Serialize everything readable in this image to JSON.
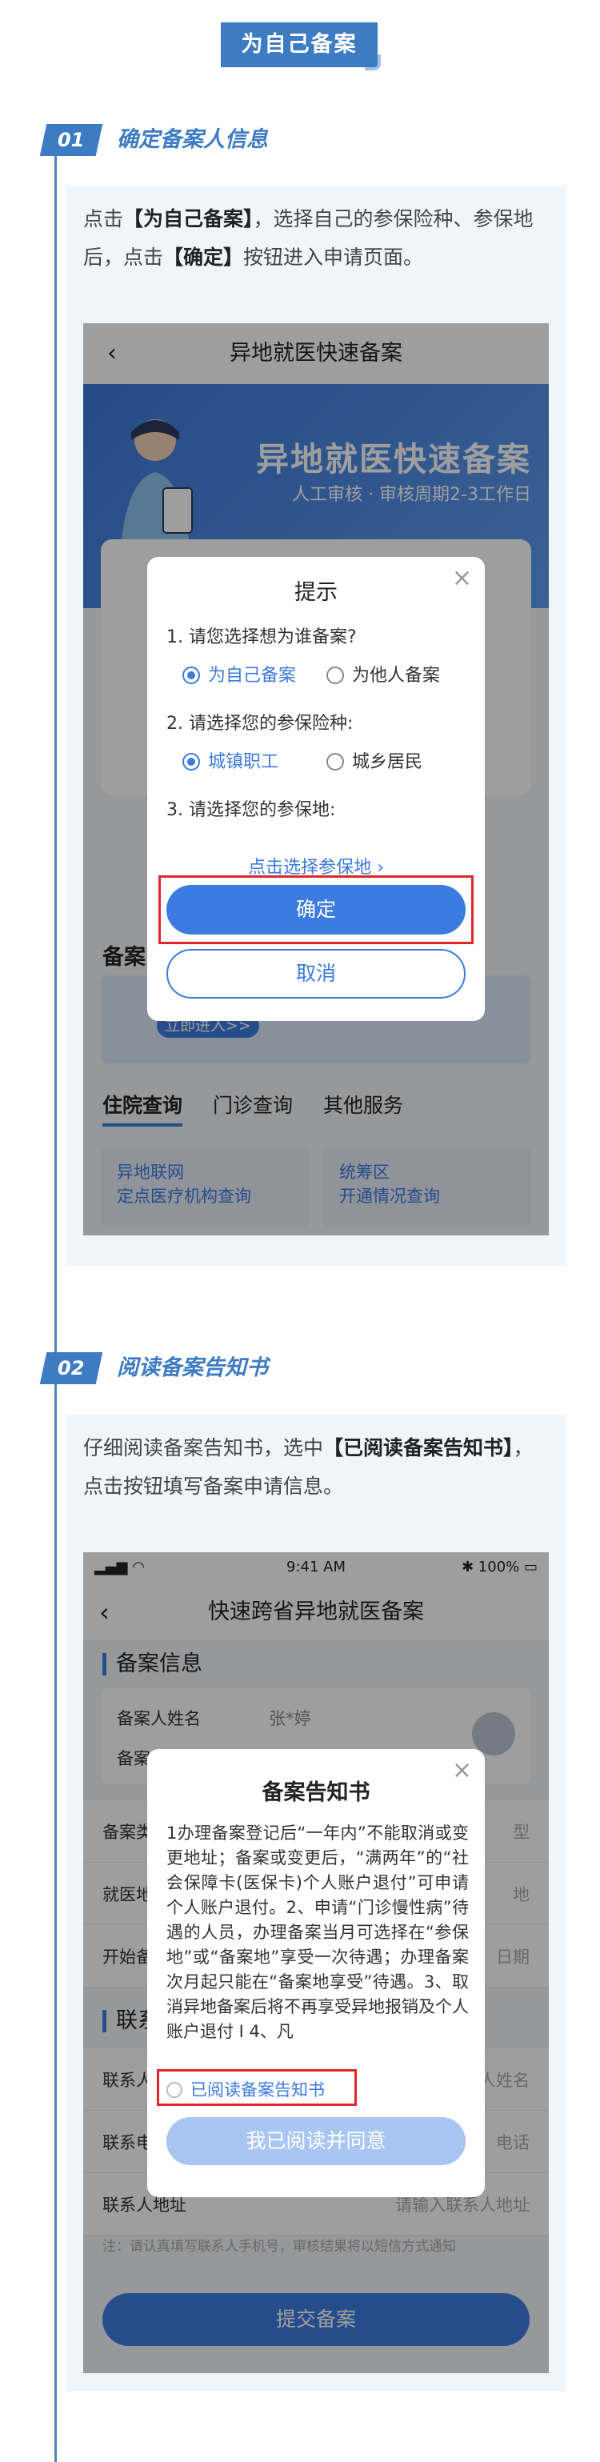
{
  "header": {
    "title": "为自己备案"
  },
  "step1": {
    "num": "01",
    "title": "确定备案人信息",
    "desc": [
      "点击",
      "【为自己备案】",
      "，选择自己的参保险种、参保地后，点击",
      "【确定】",
      "按钮进入申请页面。"
    ],
    "shot": {
      "nav_title": "异地就医快速备案",
      "banner_title": "异地就医快速备案",
      "banner_sub": "人工审核 · 审核周期2-3工作日",
      "section_label": "备案",
      "entry_button": "立即进入>>",
      "tabs": [
        "住院查询",
        "门诊查询",
        "其他服务"
      ],
      "grid": [
        {
          "line1": "异地联网",
          "line2": "定点医疗机构查询"
        },
        {
          "line1": "统筹区",
          "line2": "开通情况查询"
        }
      ]
    },
    "modal": {
      "title": "提示",
      "q1": "1. 请您选择想为谁备案?",
      "q1_options": [
        "为自己备案",
        "为他人备案"
      ],
      "q2": "2. 请选择您的参保险种:",
      "q2_options": [
        "城镇职工",
        "城乡居民"
      ],
      "q3": "3. 请选择您的参保地:",
      "location_link": "点击选择参保地 ›",
      "ok": "确定",
      "cancel": "取消"
    }
  },
  "step2": {
    "num": "02",
    "title": "阅读备案告知书",
    "desc": [
      "仔细阅读备案告知书，选中",
      "【已阅读备案告知书】",
      "，点击按钮填写备案申请信息。"
    ],
    "shot": {
      "status_time": "9:41 AM",
      "status_battery": "100%",
      "nav_title": "快速跨省异地就医备案",
      "section_info": "备案信息",
      "name_key": "备案人姓名",
      "name_value": "张*婷",
      "id_key": "备案",
      "rows": [
        {
          "k": "备案类",
          "v": "型"
        },
        {
          "k": "就医地",
          "v": "地"
        },
        {
          "k": "开始备",
          "v": "日期"
        }
      ],
      "section_contact": "联系",
      "contact_rows": [
        {
          "k": "联系人",
          "v": "人姓名"
        },
        {
          "k": "联系电",
          "v": "电话"
        },
        {
          "k": "联系人地址",
          "v": "请输入联系人地址"
        }
      ],
      "note": "注：请认真填写联系人手机号，审核结果将以短信方式通知",
      "submit": "提交备案"
    },
    "modal": {
      "title": "备案告知书",
      "body": "1办理备案登记后“一年内”不能取消或变更地址；备案或变更后，“满两年”的“社会保障卡(医保卡)个人账户退付”可申请个人账户退付。2、申请“门诊慢性病”待遇的人员，办理备案当月可选择在“参保地”或“备案地”享受一次待遇；办理备案次月起只能在“备案地享受”待遇。3、取消异地备案后将不再享受异地报销及个人账户退付 I 4、凡",
      "check": "已阅读备案告知书",
      "agree": "我已阅读并同意"
    }
  },
  "colors": {
    "accent": "#3d7cc2",
    "button": "#3c7be0",
    "highlight": "#e0262b",
    "panel": "#eef6fb"
  }
}
